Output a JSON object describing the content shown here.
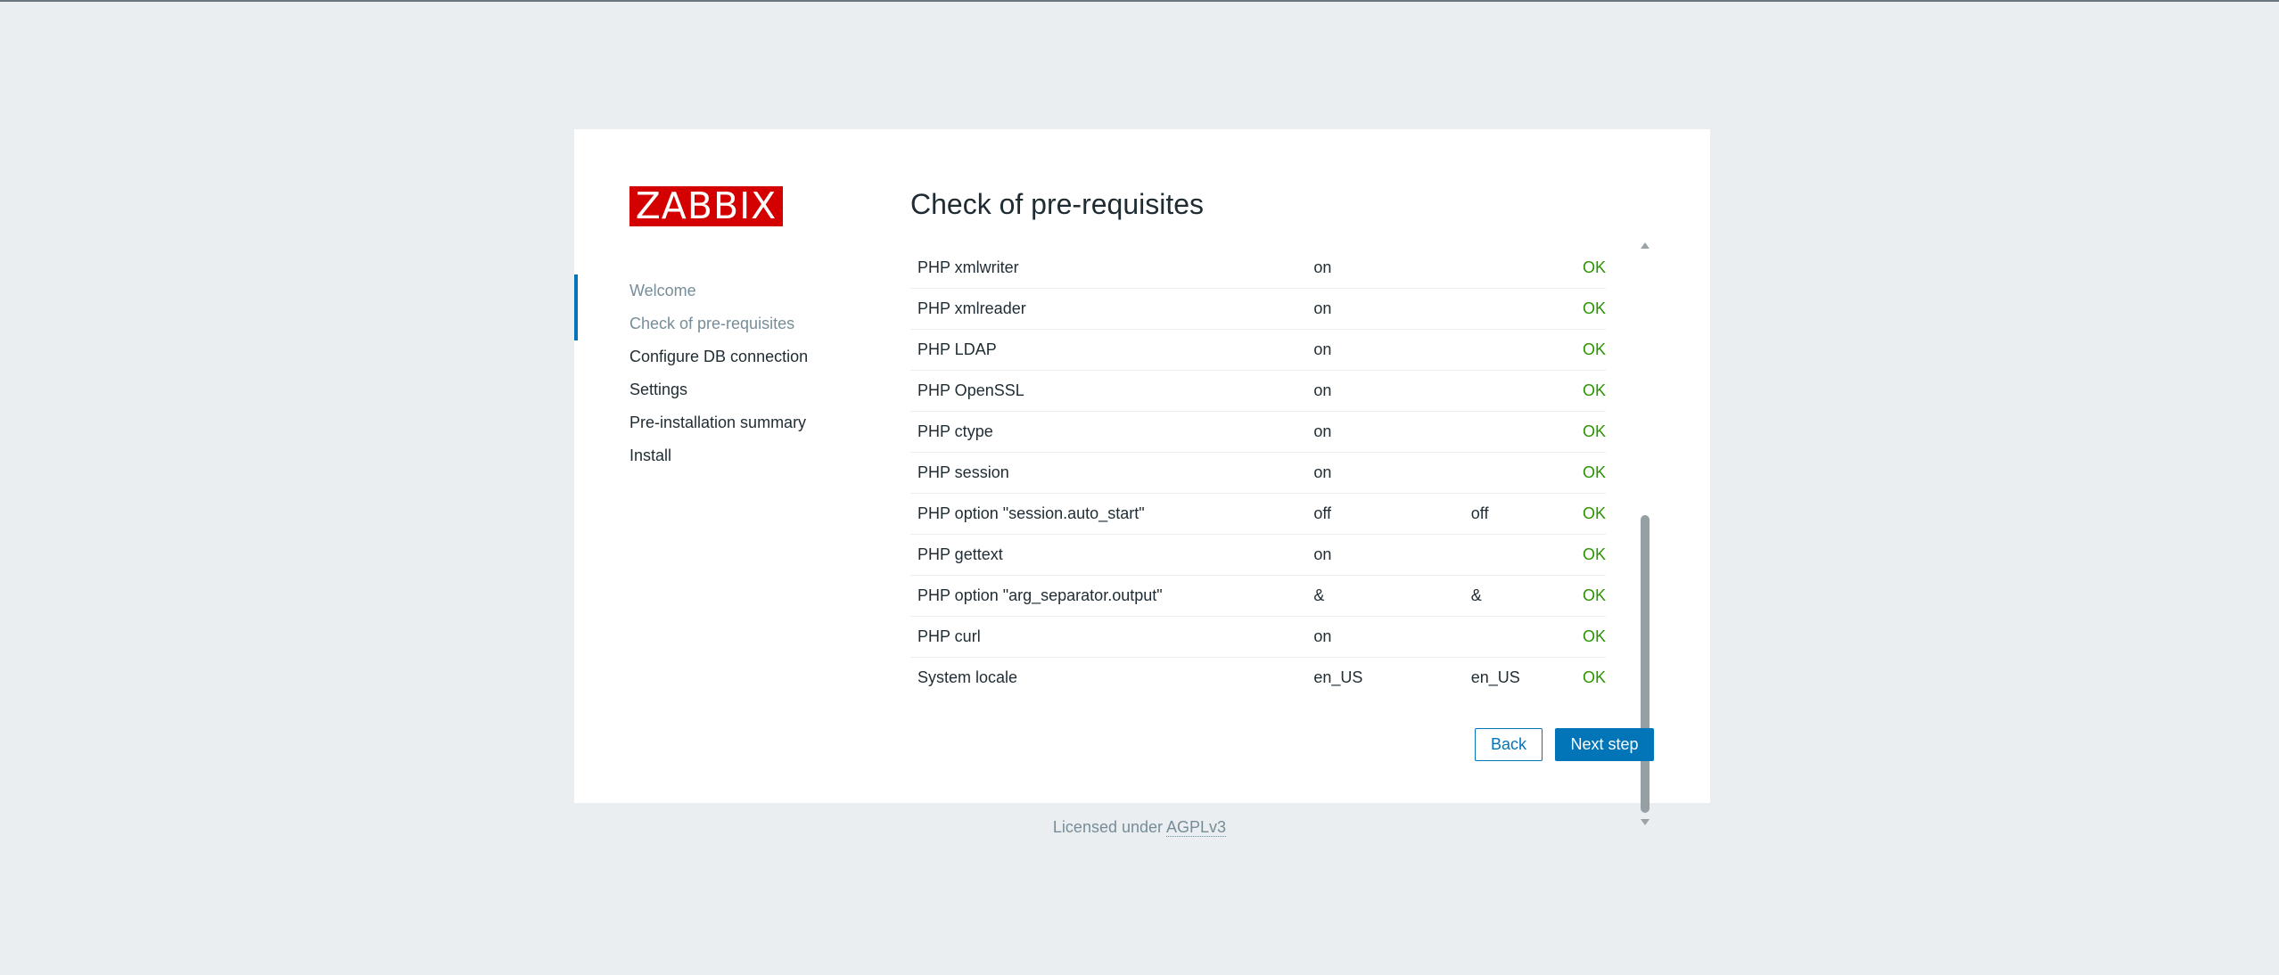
{
  "logo": {
    "text": "ZABBIX"
  },
  "title": "Check of pre-requisites",
  "steps": [
    {
      "label": "Welcome",
      "state": "done"
    },
    {
      "label": "Check of pre-requisites",
      "state": "current"
    },
    {
      "label": "Configure DB connection",
      "state": "pending"
    },
    {
      "label": "Settings",
      "state": "pending"
    },
    {
      "label": "Pre-installation summary",
      "state": "pending"
    },
    {
      "label": "Install",
      "state": "pending"
    }
  ],
  "requirements": [
    {
      "name": "PHP xmlwriter",
      "current": "on",
      "required": "",
      "status": "OK"
    },
    {
      "name": "PHP xmlreader",
      "current": "on",
      "required": "",
      "status": "OK"
    },
    {
      "name": "PHP LDAP",
      "current": "on",
      "required": "",
      "status": "OK"
    },
    {
      "name": "PHP OpenSSL",
      "current": "on",
      "required": "",
      "status": "OK"
    },
    {
      "name": "PHP ctype",
      "current": "on",
      "required": "",
      "status": "OK"
    },
    {
      "name": "PHP session",
      "current": "on",
      "required": "",
      "status": "OK"
    },
    {
      "name": "PHP option \"session.auto_start\"",
      "current": "off",
      "required": "off",
      "status": "OK"
    },
    {
      "name": "PHP gettext",
      "current": "on",
      "required": "",
      "status": "OK"
    },
    {
      "name": "PHP option \"arg_separator.output\"",
      "current": "&",
      "required": "&",
      "status": "OK"
    },
    {
      "name": "PHP curl",
      "current": "on",
      "required": "",
      "status": "OK"
    },
    {
      "name": "System locale",
      "current": "en_US",
      "required": "en_US",
      "status": "OK"
    }
  ],
  "buttons": {
    "back": "Back",
    "next": "Next step"
  },
  "footer": {
    "prefix": "Licensed under",
    "link": "AGPLv3"
  },
  "colors": {
    "brand": "#d40000",
    "accent": "#0275b8",
    "ok": "#2a9400",
    "background": "#ebeef0"
  }
}
